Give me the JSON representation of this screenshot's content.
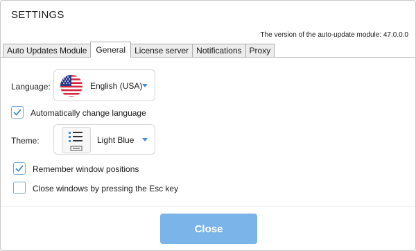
{
  "window": {
    "title": "SETTINGS"
  },
  "version_text": "The version of the auto-update module: 47.0.0.0",
  "tabs": [
    {
      "label": "Auto Updates Module",
      "active": false
    },
    {
      "label": "General",
      "active": true
    },
    {
      "label": "License server",
      "active": false
    },
    {
      "label": "Notifications",
      "active": false
    },
    {
      "label": "Proxy",
      "active": false
    }
  ],
  "general": {
    "language_label": "Language:",
    "language_value": "English (USA)",
    "language_icon": "us-flag-icon",
    "auto_change_language": {
      "label": "Automatically change language",
      "checked": true
    },
    "theme_label": "Theme:",
    "theme_value": "Light Blue",
    "theme_icon": "theme-list-icon",
    "remember_positions": {
      "label": "Remember window positions",
      "checked": true
    },
    "close_on_esc": {
      "label": "Close windows by pressing the Esc key",
      "checked": false
    }
  },
  "footer": {
    "close_label": "Close"
  },
  "colors": {
    "accent": "#3d8fd4",
    "button_bg": "#7bb4e8",
    "checkbox_border": "#6fa8d6"
  }
}
